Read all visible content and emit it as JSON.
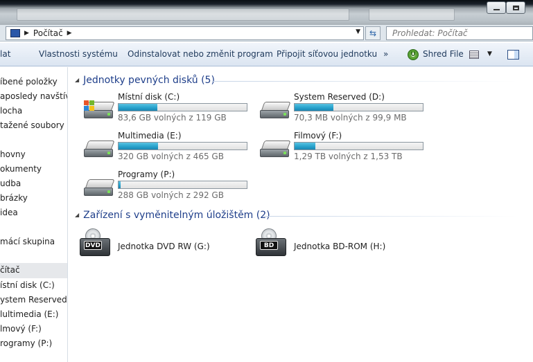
{
  "window": {
    "controls": {
      "minimize_icon": "minimize-icon",
      "maximize_icon": "maximize-icon"
    }
  },
  "address_bar": {
    "location_icon": "computer-icon",
    "crumb": "Počítač",
    "refresh_icon": "refresh-icon",
    "search_placeholder": "Prohledat: Počítač"
  },
  "command_bar": {
    "organize_label": "lat",
    "items": [
      "Vlastnosti systému",
      "Odinstalovat nebo změnit program",
      "Připojit síťovou jednotku",
      "»",
      "Shred File"
    ],
    "shred_icon_letter": "U"
  },
  "nav": {
    "items": [
      "íbené položky",
      "aposledy navštíven",
      "locha",
      "tažené soubory",
      "hovny",
      "okumenty",
      "udba",
      "brázky",
      "idea",
      "mácí skupina",
      "čítač",
      "ístní disk (C:)",
      "ystem Reserved (D:",
      "lultimedia (E:)",
      "lmový (F:)",
      "rogramy (P:)"
    ],
    "selected": "čítač"
  },
  "groups": {
    "hdd_title": "Jednotky pevných disků (5)",
    "removable_title": "Zařízení s vyměnitelným úložištěm (2)"
  },
  "drives": [
    {
      "name": "Místní disk (C:)",
      "free": "83,6 GB volných z 119 GB",
      "used_fraction": 0.3,
      "system": true
    },
    {
      "name": "System Reserved (D:)",
      "free": "70,3 MB volných z 99,9 MB",
      "used_fraction": 0.3,
      "system": false
    },
    {
      "name": "Multimedia (E:)",
      "free": "320 GB volných z 465 GB",
      "used_fraction": 0.31,
      "system": false
    },
    {
      "name": "Filmový (F:)",
      "free": "1,29 TB volných z 1,53 TB",
      "used_fraction": 0.16,
      "system": false
    },
    {
      "name": "Programy (P:)",
      "free": "288 GB volných z 292 GB",
      "used_fraction": 0.015,
      "system": false
    }
  ],
  "optical": [
    {
      "name": "Jednotka DVD RW (G:)",
      "badge": "DVD"
    },
    {
      "name": "Jednotka BD-ROM (H:)",
      "badge": "BD"
    }
  ],
  "colors": {
    "header_text": "#1e3e8a",
    "bar_fill": "#2ba6cf",
    "command_text": "#1e395b"
  }
}
